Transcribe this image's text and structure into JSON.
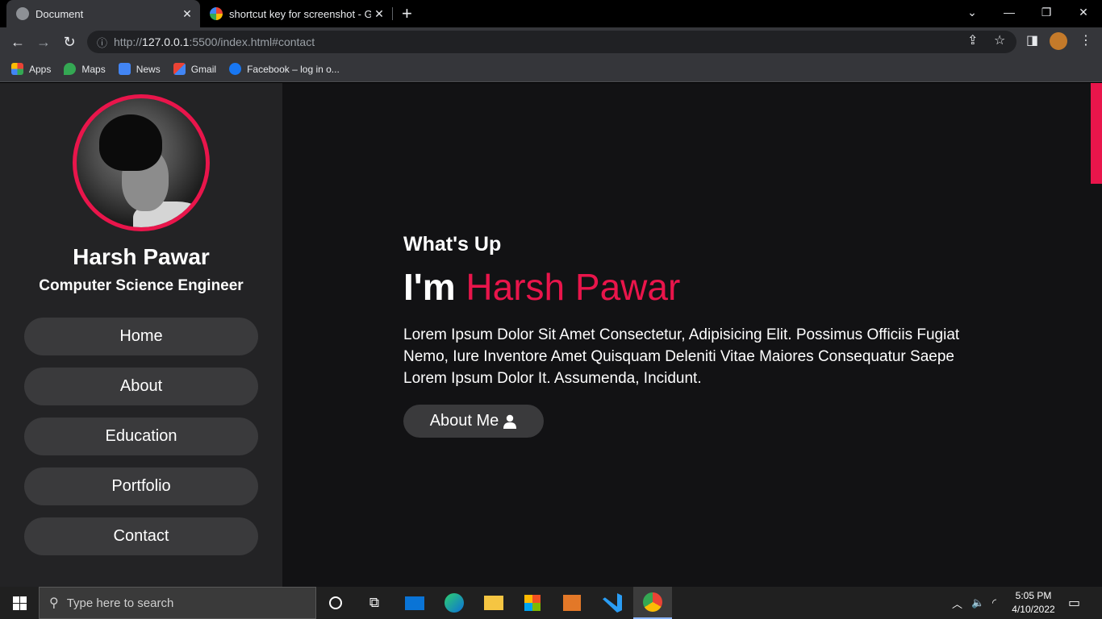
{
  "browser": {
    "tabs": [
      {
        "title": "Document",
        "active": true
      },
      {
        "title": "shortcut key for screenshot - Goo",
        "active": false
      }
    ],
    "url_scheme": "http://",
    "url_host": "127.0.0.1",
    "url_rest": ":5500/index.html#contact",
    "bookmarks": [
      {
        "label": "Apps",
        "icon": "apps-grid-icon"
      },
      {
        "label": "Maps",
        "icon": "maps-pin-icon"
      },
      {
        "label": "News",
        "icon": "news-icon"
      },
      {
        "label": "Gmail",
        "icon": "gmail-icon"
      },
      {
        "label": "Facebook – log in o...",
        "icon": "facebook-icon"
      }
    ]
  },
  "sidebar": {
    "name": "Harsh Pawar",
    "role": "Computer Science Engineer",
    "nav": [
      {
        "label": "Home"
      },
      {
        "label": "About"
      },
      {
        "label": "Education"
      },
      {
        "label": "Portfolio"
      },
      {
        "label": "Contact"
      }
    ]
  },
  "hero": {
    "greeting": "What's Up",
    "intro": "I'm",
    "name": "Harsh Pawar",
    "description": "Lorem Ipsum Dolor Sit Amet Consectetur, Adipisicing Elit. Possimus Officiis Fugiat Nemo, Iure Inventore Amet Quisquam Deleniti Vitae Maiores Consequatur Saepe Lorem Ipsum Dolor It. Assumenda, Incidunt.",
    "button_label": "About Me"
  },
  "taskbar": {
    "search_placeholder": "Type here to search",
    "time": "5:05 PM",
    "date": "4/10/2022"
  },
  "colors": {
    "accent": "#e9154b",
    "page_bg": "#121214",
    "sidebar_bg": "#232325",
    "button_bg": "#3a3a3c"
  }
}
